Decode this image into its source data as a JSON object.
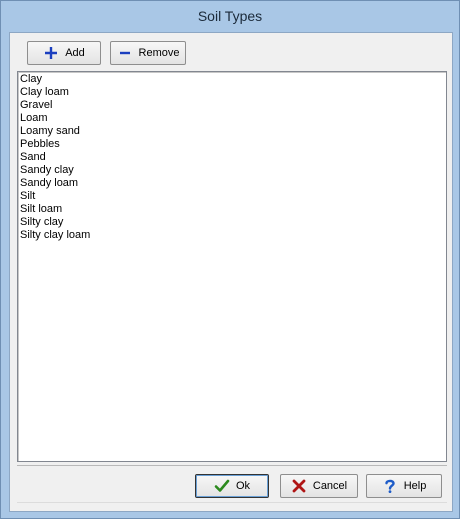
{
  "window": {
    "title": "Soil Types"
  },
  "toolbar": {
    "add_label": "Add",
    "remove_label": "Remove"
  },
  "list": {
    "items": [
      "Clay",
      "Clay loam",
      "Gravel",
      "Loam",
      "Loamy sand",
      "Pebbles",
      "Sand",
      "Sandy clay",
      "Sandy loam",
      "Silt",
      "Silt loam",
      "Silty clay",
      "Silty clay loam"
    ]
  },
  "footer": {
    "ok_label": "Ok",
    "cancel_label": "Cancel",
    "help_label": "Help"
  },
  "icons": {
    "add": "plus-icon",
    "remove": "minus-icon",
    "ok": "checkmark-icon",
    "cancel": "x-icon",
    "help": "question-mark-icon"
  },
  "colors": {
    "plus": "#1b3fbf",
    "minus": "#1b3fbf",
    "check": "#2c8a1e",
    "cancel": "#b01515",
    "help": "#1e5cc8",
    "titlebar": "#a9c7e6"
  }
}
